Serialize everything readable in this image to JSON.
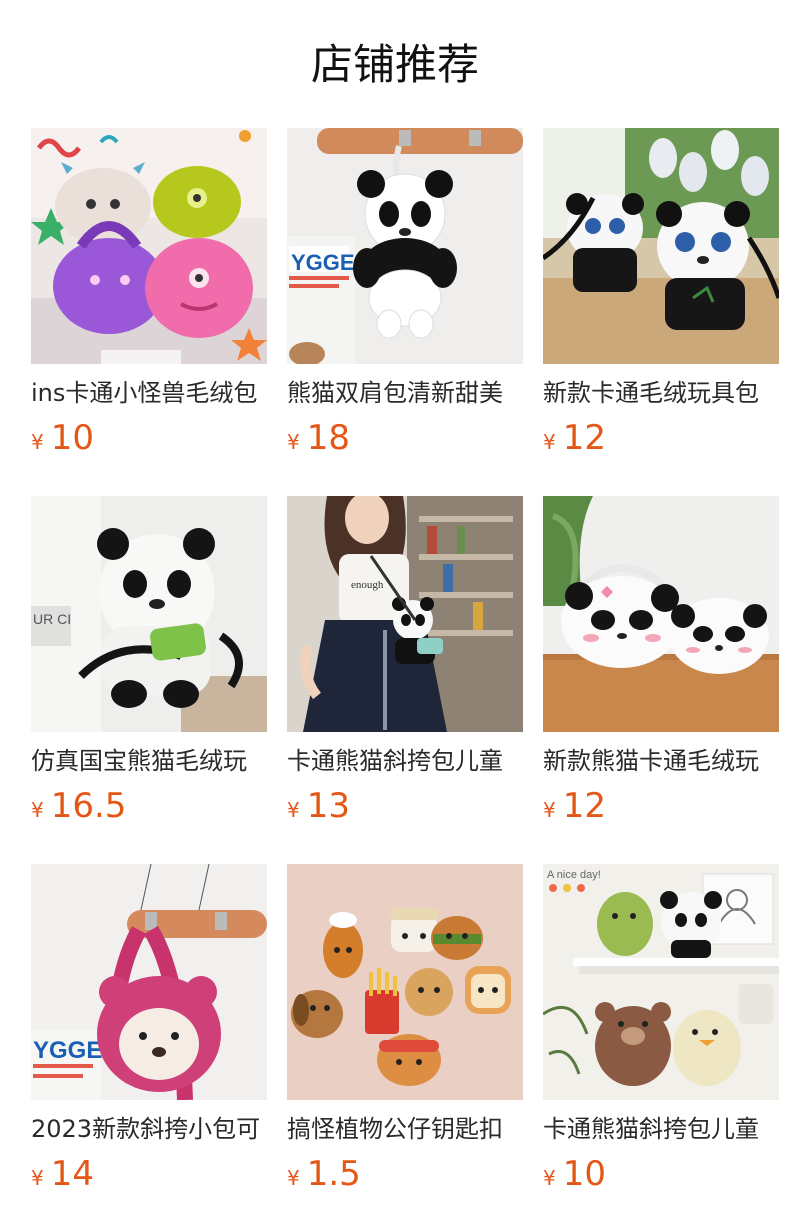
{
  "section": {
    "title": "店铺推荐"
  },
  "products": [
    {
      "name": "ins卡通小怪兽毛绒包",
      "currency": "¥",
      "price": "10",
      "image_icon": "plush-monster-bags-image"
    },
    {
      "name": "熊猫双肩包清新甜美",
      "currency": "¥",
      "price": "18",
      "image_icon": "panda-backpack-image"
    },
    {
      "name": "新款卡通毛绒玩具包",
      "currency": "¥",
      "price": "12",
      "image_icon": "panda-crossbody-bags-image"
    },
    {
      "name": "仿真国宝熊猫毛绒玩",
      "currency": "¥",
      "price": "16.5",
      "image_icon": "panda-plush-backpack-image"
    },
    {
      "name": "卡通熊猫斜挎包儿童",
      "currency": "¥",
      "price": "13",
      "image_icon": "model-with-panda-bag-image"
    },
    {
      "name": "新款熊猫卡通毛绒玩",
      "currency": "¥",
      "price": "12",
      "image_icon": "panda-face-bags-image"
    },
    {
      "name": "2023新款斜挎小包可",
      "currency": "¥",
      "price": "14",
      "image_icon": "pink-bear-bag-image"
    },
    {
      "name": "搞怪植物公仔钥匙扣",
      "currency": "¥",
      "price": "1.5",
      "image_icon": "food-keychains-image"
    },
    {
      "name": "卡通熊猫斜挎包儿童",
      "currency": "¥",
      "price": "10",
      "image_icon": "plush-animals-shelf-image"
    }
  ],
  "colors": {
    "price": "#e45716",
    "title": "#111111",
    "name": "#2a2a2a",
    "background": "#ffffff"
  }
}
